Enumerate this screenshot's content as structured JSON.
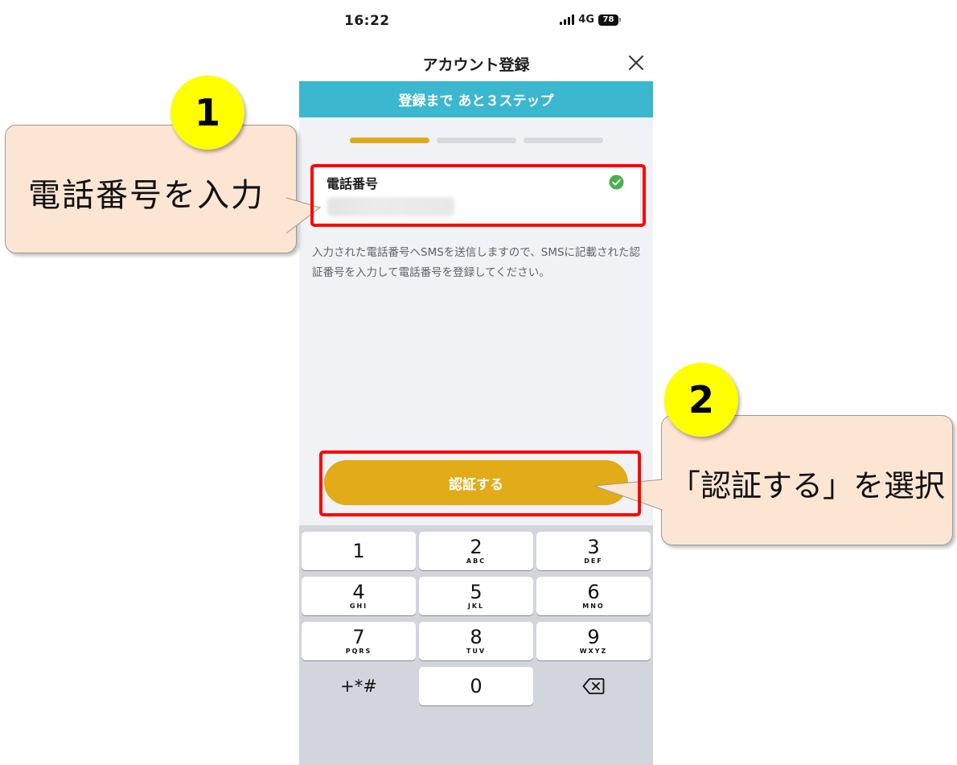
{
  "status_bar": {
    "time": "16:22",
    "network": "4G",
    "battery": "78"
  },
  "nav": {
    "title": "アカウント登録",
    "close_icon": "close-icon"
  },
  "banner": {
    "text": "登録まで あと３ステップ"
  },
  "progress": {
    "total_steps": 3,
    "current_step": 1,
    "active_color": "#e0a818"
  },
  "phone_field": {
    "label": "電話番号",
    "value": "090-1234-5678",
    "status_icon": "check-circle-icon"
  },
  "notice": {
    "text": "入力された電話番号へSMSを送信しますので、SMSに記載された認証番号を入力して電話番号を登録してください。"
  },
  "verify_button": {
    "label": "認証する"
  },
  "keypad": {
    "keys": [
      {
        "num": "1",
        "letters": ""
      },
      {
        "num": "2",
        "letters": "ABC"
      },
      {
        "num": "3",
        "letters": "DEF"
      },
      {
        "num": "4",
        "letters": "GHI"
      },
      {
        "num": "5",
        "letters": "JKL"
      },
      {
        "num": "6",
        "letters": "MNO"
      },
      {
        "num": "7",
        "letters": "PQRS"
      },
      {
        "num": "8",
        "letters": "TUV"
      },
      {
        "num": "9",
        "letters": "WXYZ"
      }
    ],
    "symbols": "+*#",
    "zero": "0",
    "delete_icon": "delete-backspace-icon"
  },
  "annotations": {
    "step1": {
      "number": "1",
      "text": "電話番号を入力"
    },
    "step2": {
      "number": "2",
      "text": "「認証する」を選択"
    },
    "highlight_color": "#ff0000",
    "badge_color": "#ffff00",
    "callout_color": "#fde5d4"
  },
  "colors": {
    "banner": "#3bb7cf",
    "accent": "#e2ab18",
    "check": "#4caf50"
  }
}
